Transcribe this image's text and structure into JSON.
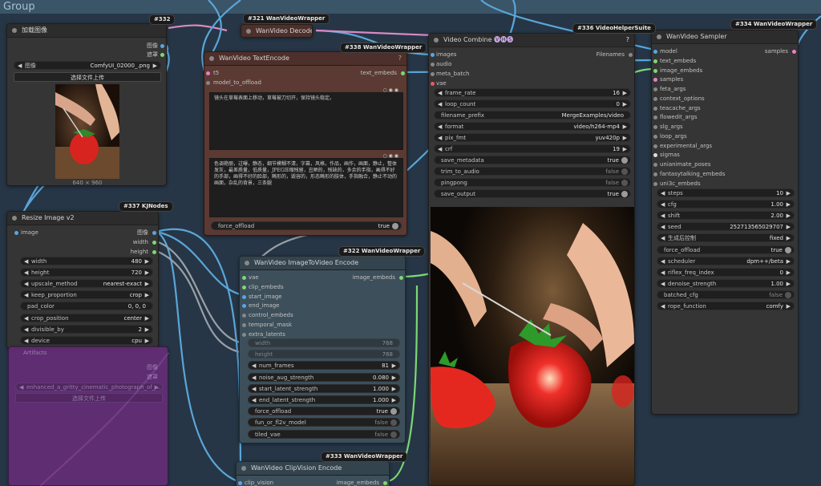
{
  "group": {
    "title": "Group"
  },
  "colors": {
    "wire_blue": "#5aa6d8",
    "wire_pink": "#d889c2",
    "wire_grey": "#9aa0a6",
    "pin_green": "#7cd873",
    "pin_blue": "#58a6e8",
    "pin_pink": "#e87fc8",
    "textencode_bg": "#5a3a33",
    "video_bg": "#3d4f5a",
    "purple_bg": "#6a2c7a"
  },
  "nodes": {
    "load_image": {
      "id": "#332",
      "title": "加载图像",
      "outputs": [
        "图像",
        "遮罩"
      ],
      "image_widget": {
        "label": "图像",
        "value": "ComfyUI_02000_.png"
      },
      "upload_button": "选择文件上传",
      "preview_size": "640 × 960"
    },
    "decode": {
      "id": "#321 WanVideoWrapper",
      "title": "WanVideo Decode"
    },
    "text_encode": {
      "id": "#338 WanVideoWrapper",
      "title": "WanVideo TextEncode",
      "inputs": [
        "t5",
        "model_to_offload"
      ],
      "output": "text_embeds",
      "help": "?",
      "positive_prompt": "镜头在草莓表面上移动，草莓被刀切开，保持镜头稳定。",
      "negative_prompt": "色调艳丽，过曝，静态，细节模糊不清，字幕，风格，作品，画作，画面，静止，整体发灰，最差质量，低质量，JPEG压缩残留，丑陋的，残缺的，多余的手指，画得不好的手部，画得不好的脸部，畸形的，毁容的，形态畸形的肢体，手指融合，静止不动的画面，杂乱的背景，三条腿",
      "force_offload": {
        "label": "force_offload",
        "value": "true"
      }
    },
    "video_combine": {
      "id": "#336 VideoHelperSuite",
      "title": "Video Combine",
      "suffix": "🅥🅗🅢",
      "inputs": [
        "images",
        "audio",
        "meta_batch",
        "vae"
      ],
      "output": "Filenames",
      "help": "?",
      "widgets": [
        {
          "label": "frame_rate",
          "value": "16",
          "kind": "num"
        },
        {
          "label": "loop_count",
          "value": "0",
          "kind": "num"
        },
        {
          "label": "filename_prefix",
          "value": "MergeExamples/video",
          "kind": "text"
        },
        {
          "label": "format",
          "value": "video/h264-mp4",
          "kind": "combo"
        },
        {
          "label": "pix_fmt",
          "value": "yuv420p",
          "kind": "combo"
        },
        {
          "label": "crf",
          "value": "19",
          "kind": "num"
        },
        {
          "label": "save_metadata",
          "value": "true",
          "kind": "tog"
        },
        {
          "label": "trim_to_audio",
          "value": "false",
          "kind": "togoff"
        },
        {
          "label": "pingpong",
          "value": "false",
          "kind": "togoff"
        },
        {
          "label": "save_output",
          "value": "true",
          "kind": "tog"
        }
      ]
    },
    "sampler": {
      "id": "#334 WanVideoWrapper",
      "title": "WanVideo Sampler",
      "output": "samples",
      "inputs": [
        "model",
        "text_embeds",
        "image_embeds",
        "samples",
        "feta_args",
        "context_options",
        "teacache_args",
        "flowedit_args",
        "slg_args",
        "loop_args",
        "experimental_args",
        "sigmas",
        "unianimate_poses",
        "fantasytalking_embeds",
        "uni3c_embeds"
      ],
      "widgets": [
        {
          "label": "steps",
          "value": "10",
          "kind": "num"
        },
        {
          "label": "cfg",
          "value": "1.00",
          "kind": "num"
        },
        {
          "label": "shift",
          "value": "2.00",
          "kind": "num"
        },
        {
          "label": "seed",
          "value": "252713565029707",
          "kind": "num"
        },
        {
          "label": "生成后控制",
          "value": "fixed",
          "kind": "combo"
        },
        {
          "label": "force_offload",
          "value": "true",
          "kind": "tog"
        },
        {
          "label": "scheduler",
          "value": "dpm++/beta",
          "kind": "combo"
        },
        {
          "label": "riflex_freq_index",
          "value": "0",
          "kind": "num"
        },
        {
          "label": "denoise_strength",
          "value": "1.00",
          "kind": "num"
        },
        {
          "label": "batched_cfg",
          "value": "false",
          "kind": "togoff"
        },
        {
          "label": "rope_function",
          "value": "comfy",
          "kind": "combo"
        }
      ]
    },
    "resize": {
      "id": "#337 KJNodes",
      "title": "Resize Image v2",
      "input": "image",
      "outputs": [
        "图像",
        "width",
        "height"
      ],
      "widgets": [
        {
          "label": "width",
          "value": "480",
          "kind": "num"
        },
        {
          "label": "height",
          "value": "720",
          "kind": "num"
        },
        {
          "label": "upscale_method",
          "value": "nearest-exact",
          "kind": "combo"
        },
        {
          "label": "keep_proportion",
          "value": "crop",
          "kind": "combo"
        },
        {
          "label": "pad_color",
          "value": "0, 0, 0",
          "kind": "text"
        },
        {
          "label": "crop_position",
          "value": "center",
          "kind": "combo"
        },
        {
          "label": "divisible_by",
          "value": "2",
          "kind": "num"
        },
        {
          "label": "device",
          "value": "cpu",
          "kind": "combo"
        }
      ]
    },
    "i2v_encode": {
      "id": "#322 WanVideoWrapper",
      "title": "WanVideo ImageToVideo Encode",
      "inputs": [
        "vae",
        "clip_embeds",
        "start_image",
        "end_image",
        "control_embeds",
        "temporal_mask",
        "extra_latents"
      ],
      "output": "image_embeds",
      "widgets": [
        {
          "label": "width",
          "value": "768",
          "kind": "dis"
        },
        {
          "label": "height",
          "value": "768",
          "kind": "dis"
        },
        {
          "label": "num_frames",
          "value": "81",
          "kind": "num"
        },
        {
          "label": "noise_aug_strength",
          "value": "0.080",
          "kind": "num"
        },
        {
          "label": "start_latent_strength",
          "value": "1.000",
          "kind": "num"
        },
        {
          "label": "end_latent_strength",
          "value": "1.000",
          "kind": "num"
        },
        {
          "label": "force_offload",
          "value": "true",
          "kind": "tog"
        },
        {
          "label": "fun_or_fl2v_model",
          "value": "false",
          "kind": "togoff"
        },
        {
          "label": "tiled_vae",
          "value": "false",
          "kind": "togoff"
        }
      ]
    },
    "clipvision": {
      "id": "#333 WanVideoWrapper",
      "title": "WanVideo ClipVision Encode",
      "input": "clip_vision",
      "output": "image_embeds"
    },
    "purple_node": {
      "outputs": [
        "图像",
        "遮罩"
      ],
      "prompt": "enhanced_a_gritty_cinematic_photograph_of_...",
      "upload_button": "选择文件上传",
      "title": "Artifacts"
    }
  }
}
